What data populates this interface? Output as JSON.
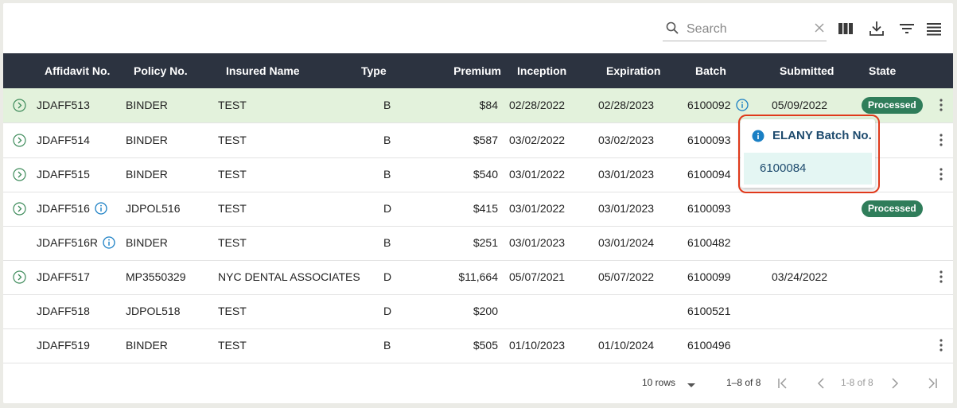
{
  "toolbar": {
    "search_placeholder": "Search",
    "search_value": "",
    "icons": [
      "search-icon",
      "clear-icon",
      "columns-icon",
      "download-icon",
      "filter-icon",
      "menu-icon"
    ]
  },
  "columns": [
    "Affidavit No.",
    "Policy No.",
    "Insured Name",
    "Type",
    "Premium",
    "Inception",
    "Expiration",
    "Batch",
    "Submitted",
    "State"
  ],
  "rows": [
    {
      "affidavit": "JDAFF513",
      "policy": "BINDER",
      "insured": "TEST",
      "type": "B",
      "premium": "$84",
      "inception": "02/28/2022",
      "expiration": "02/28/2023",
      "batch": "6100092",
      "submitted": "05/09/2022",
      "state": "Processed"
    },
    {
      "affidavit": "JDAFF514",
      "policy": "BINDER",
      "insured": "TEST",
      "type": "B",
      "premium": "$587",
      "inception": "03/02/2022",
      "expiration": "03/02/2023",
      "batch": "6100093",
      "submitted": "",
      "state": ""
    },
    {
      "affidavit": "JDAFF515",
      "policy": "BINDER",
      "insured": "TEST",
      "type": "B",
      "premium": "$540",
      "inception": "03/01/2022",
      "expiration": "03/01/2023",
      "batch": "6100094",
      "submitted": "",
      "state": ""
    },
    {
      "affidavit": "JDAFF516",
      "policy": "JDPOL516",
      "insured": "TEST",
      "type": "D",
      "premium": "$415",
      "inception": "03/01/2022",
      "expiration": "03/01/2023",
      "batch": "6100093",
      "submitted": "",
      "state": "Processed"
    },
    {
      "affidavit": "JDAFF516R",
      "policy": "BINDER",
      "insured": "TEST",
      "type": "B",
      "premium": "$251",
      "inception": "03/01/2023",
      "expiration": "03/01/2024",
      "batch": "6100482",
      "submitted": "",
      "state": ""
    },
    {
      "affidavit": "JDAFF517",
      "policy": "MP3550329",
      "insured": "NYC DENTAL ASSOCIATES",
      "type": "D",
      "premium": "$11,664",
      "inception": "05/07/2021",
      "expiration": "05/07/2022",
      "batch": "6100099",
      "submitted": "03/24/2022",
      "state": ""
    },
    {
      "affidavit": "JDAFF518",
      "policy": "JDPOL518",
      "insured": "TEST",
      "type": "D",
      "premium": "$200",
      "inception": "",
      "expiration": "",
      "batch": "6100521",
      "submitted": "",
      "state": ""
    },
    {
      "affidavit": "JDAFF519",
      "policy": "BINDER",
      "insured": "TEST",
      "type": "B",
      "premium": "$505",
      "inception": "01/10/2023",
      "expiration": "01/10/2024",
      "batch": "6100496",
      "submitted": "",
      "state": ""
    }
  ],
  "popover": {
    "title": "ELANY Batch No.",
    "value": "6100084"
  },
  "footer": {
    "rows_per_page": "10 rows",
    "range": "1–8 of 8",
    "page_info": "1-8 of 8"
  },
  "colors": {
    "header_bg": "#2c3340",
    "selected_row_bg": "#e3f2dc",
    "badge_bg": "#2f7d5a",
    "accent_blue": "#1a7fc4",
    "highlight_border": "#e0391b"
  }
}
